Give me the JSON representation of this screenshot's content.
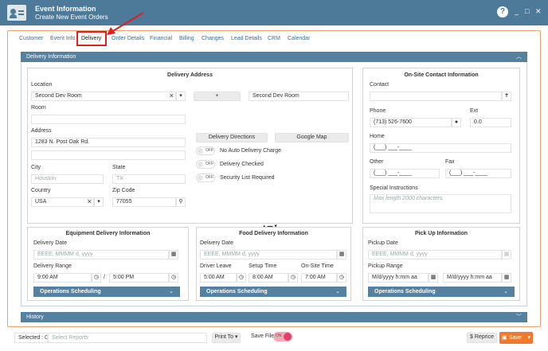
{
  "window": {
    "title": "Event Information",
    "subtitle": "Create New Event Orders",
    "help": "?",
    "minimize": "_",
    "maximize": "□",
    "close": "✕"
  },
  "tabs": [
    "Customer",
    "Event Info",
    "Delivery",
    "Order Details",
    "Financial",
    "Billing",
    "Changes",
    "Lead Details",
    "CRM",
    "Calendar"
  ],
  "active_tab": "Delivery",
  "colors": {
    "header": "#4e7a99",
    "accent": "#ef7a2e",
    "highlight": "#e02020"
  },
  "delivery_panel": {
    "title": "Delivery Information",
    "address": {
      "title": "Delivery Address",
      "location_label": "Location",
      "location_value": "Second Dev Room",
      "add_button": "+",
      "location_display": "Second Dev Room",
      "room_label": "Room",
      "room_value": "",
      "address_label": "Address",
      "address_line1": "1283 N. Post Oak Rd.",
      "address_line2": "",
      "directions_button": "Delivery Directions",
      "map_button": "Google Map",
      "toggle_off": "OFF",
      "no_auto_charge": "No Auto Delivery Charge",
      "delivery_checked": "Delivery Checked",
      "security_required": "Security List Required",
      "city_label": "City",
      "city_value": "Houston",
      "state_label": "State",
      "state_value": "TX",
      "country_label": "Country",
      "country_value": "USA",
      "zip_label": "Zip Code",
      "zip_value": "77055"
    },
    "contact": {
      "title": "On-Site Contact Information",
      "contact_label": "Contact",
      "contact_value": "",
      "phone_label": "Phone",
      "phone_value": "(713) 526-7600",
      "ext_label": "Ext",
      "ext_value": "0.0",
      "home_label": "Home",
      "home_value": "(___) ___-____",
      "other_label": "Other",
      "other_value": "(___) ___-____",
      "fax_label": "Fax",
      "fax_value": "(___) ___-____",
      "special_label": "Special Instructions",
      "special_placeholder": "Max length 2000 characters."
    },
    "equipment": {
      "title": "Equipment Delivery Information",
      "date_label": "Delivery Date",
      "date_placeholder": "EEEE, MMMM d, yyyy",
      "range_label": "Delivery Range",
      "range_start": "9:00 AM",
      "range_sep": "/",
      "range_end": "5:00 PM",
      "ops": "Operations Scheduling"
    },
    "food": {
      "title": "Food Delivery Information",
      "date_label": "Delivery Date",
      "date_placeholder": "EEEE, MMMM d, yyyy",
      "leave_label": "Driver Leave",
      "leave_value": "5:00 AM",
      "setup_label": "Setup Time",
      "setup_value": "8:00 AM",
      "onsite_label": "On-Site Time",
      "onsite_value": "7:00 AM",
      "ops": "Operations Scheduling"
    },
    "pickup": {
      "title": "Pick Up Information",
      "date_label": "Pickup Date",
      "date_placeholder": "EEEE, MMMM d, yyyy",
      "range_label": "Pickup Range",
      "range_start": "M/d/yyyy h:mm aa",
      "range_end": "M/d/yyyy h:mm aa",
      "ops": "Operations Scheduling"
    }
  },
  "history": {
    "title": "History"
  },
  "footer": {
    "selected": "Selected : 0",
    "reports_placeholder": "Select Reports",
    "print_to": "Print To",
    "save_file": "Save File",
    "toggle_on": "ON",
    "reprice": "Reprice",
    "reprice_symbol": "$",
    "save": "Save"
  }
}
